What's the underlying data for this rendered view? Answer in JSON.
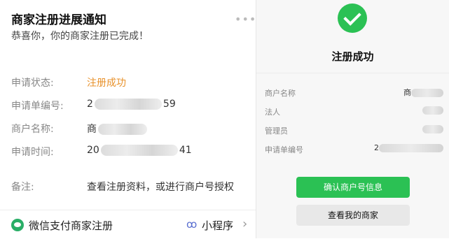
{
  "notice": {
    "title": "商家注册进展通知",
    "more": "•••",
    "subtitle": "恭喜你，你的商家注册已完成！",
    "rows": [
      {
        "label": "申请状态:",
        "value": "注册成功"
      },
      {
        "label": "申请单编号:",
        "prefix": "2",
        "suffix": "59"
      },
      {
        "label": "商户名称:",
        "prefix": "商",
        "suffix": ""
      },
      {
        "label": "申请时间:",
        "prefix": "20",
        "suffix": "41"
      },
      {
        "label": "备注:",
        "value": "查看注册资料，或进行商户号授权"
      }
    ]
  },
  "footer": {
    "app_name": "微信支付商家注册",
    "mini_program_icon": "ꝏ",
    "mini_program_label": "小程序",
    "chevron": "›"
  },
  "result": {
    "title": "注册成功",
    "rows": [
      {
        "label": "商户名称",
        "prefix": "商"
      },
      {
        "label": "法人",
        "prefix": ""
      },
      {
        "label": "管理员",
        "prefix": ""
      },
      {
        "label": "申请单编号",
        "prefix": "2"
      }
    ],
    "confirm_button": "确认商户号信息",
    "view_button": "查看我的商家"
  },
  "colors": {
    "success_green": "#2bc154",
    "status_orange": "#e8922c"
  }
}
